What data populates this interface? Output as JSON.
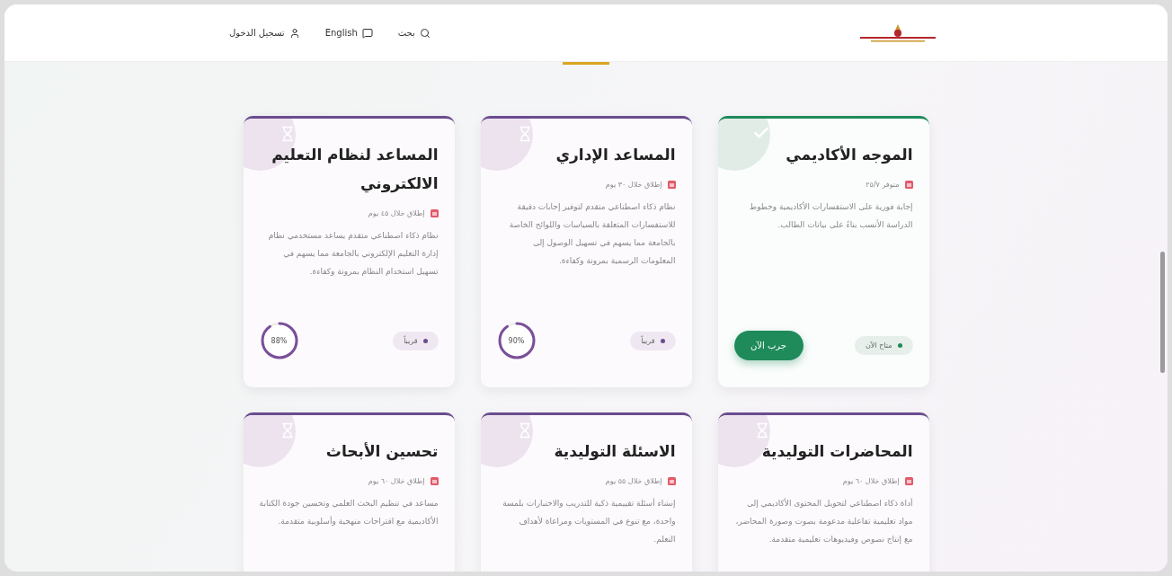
{
  "header": {
    "nav": [
      {
        "kind": "search",
        "label": "بحث"
      },
      {
        "kind": "language",
        "label": "English"
      },
      {
        "kind": "login",
        "label": "تسجيل الدخول"
      }
    ]
  },
  "cards": [
    {
      "kind": "available",
      "title": "الموجه الأكاديمي",
      "meta": "متوفر ٢٥/٧",
      "description": "إجابة فورية على الاستفسارات الأكاديمية وخطوط الدراسة الأنسب بناءً على بيانات الطالب.",
      "status": "متاح الآن",
      "action": "جرب الآن"
    },
    {
      "kind": "soon",
      "title": "المساعد الإداري",
      "meta": "إطلاق خلال ٣٠ يوم",
      "description": "نظام ذكاء اصطناعي متقدم لتوفير إجابات دقيقة للاستفسارات المتعلقة بالسياسات واللوائح الخاصة بالجامعة مما يسهم في تسهيل الوصول إلى المعلومات الرسمية بمرونة وكفاءة.",
      "status": "قريباً",
      "reading": "90%"
    },
    {
      "kind": "soon",
      "title": "المساعد لنظام التعليم الالكتروني",
      "meta": "إطلاق خلال ٤٥ يوم",
      "description": "نظام ذكاء اصطناعي متقدم يساعد مستخدمي نظام إدارة التعليم الإلكتروني بالجامعة مما يسهم في تسهيل استخدام النظام بمرونة وكفاءة.",
      "status": "قريباً",
      "reading": "88%"
    },
    {
      "kind": "soon",
      "title": "المحاضرات التوليدية",
      "meta": "إطلاق خلال ٦٠ يوم",
      "description": "أداة ذكاء اصطناعي لتحويل المحتوى الأكاديمي إلى مواد تعليمية تفاعلية مدعومة بصوت وصورة المحاضر، مع إنتاج نصوص وفيديوهات تعليمية متقدمة."
    },
    {
      "kind": "soon",
      "title": "الاسئلة التوليدية",
      "meta": "إطلاق خلال ٥٥ يوم",
      "description": "إنشاء أسئلة تقييمية ذكية للتدريب والاختبارات بلمسة واحدة، مع تنوع في المستويات ومراعاة لأهداف التعلم."
    },
    {
      "kind": "soon",
      "title": "تحسين الأبحاث",
      "meta": "إطلاق خلال ٦٠ يوم",
      "description": "مساعد في تنظيم البحث العلمي وتحسين جودة الكتابة الأكاديمية مع اقتراحات منهجية وأسلوبية متقدمة."
    }
  ]
}
